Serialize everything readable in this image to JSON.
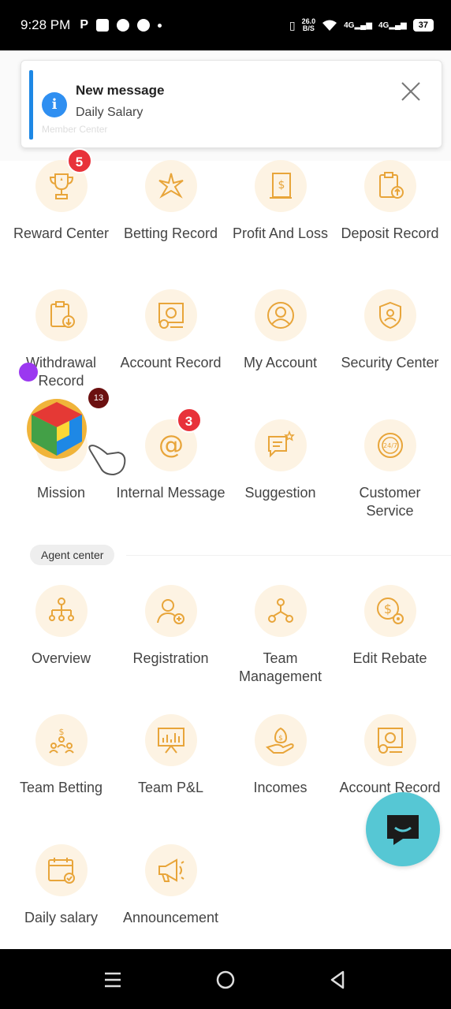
{
  "status_bar": {
    "time": "9:28 PM",
    "speed_value": "26.0",
    "speed_unit": "B/S",
    "network_1": "4G",
    "network_2": "4G",
    "battery": "37"
  },
  "notification": {
    "title": "New message",
    "body": "Daily Salary",
    "background_hint": "Member Center"
  },
  "member_center": {
    "items": [
      {
        "label": "Reward Center",
        "icon": "trophy-icon",
        "badge": "5"
      },
      {
        "label": "Betting Record",
        "icon": "star-burst-icon"
      },
      {
        "label": "Profit And Loss",
        "icon": "dollar-document-icon"
      },
      {
        "label": "Deposit Record",
        "icon": "clipboard-upload-icon"
      },
      {
        "label": "Withdrawal Record",
        "icon": "clipboard-download-icon"
      },
      {
        "label": "Account Record",
        "icon": "account-record-icon"
      },
      {
        "label": "My Account",
        "icon": "user-circle-icon"
      },
      {
        "label": "Security Center",
        "icon": "shield-user-icon"
      },
      {
        "label": "Mission",
        "icon": "mission-icon"
      },
      {
        "label": "Internal Message",
        "icon": "at-sign-icon",
        "badge": "3"
      },
      {
        "label": "Suggestion",
        "icon": "chat-star-icon"
      },
      {
        "label": "Customer Service",
        "icon": "support-24-7-icon"
      }
    ]
  },
  "agent_center": {
    "title": "Agent center",
    "items": [
      {
        "label": "Overview",
        "icon": "org-chart-icon"
      },
      {
        "label": "Registration",
        "icon": "add-user-icon"
      },
      {
        "label": "Team Management",
        "icon": "team-icon"
      },
      {
        "label": "Edit Rebate",
        "icon": "dollar-gear-icon"
      },
      {
        "label": "Team Betting",
        "icon": "team-betting-icon"
      },
      {
        "label": "Team P&L",
        "icon": "chart-board-icon"
      },
      {
        "label": "Incomes",
        "icon": "money-hand-icon"
      },
      {
        "label": "Account Record",
        "icon": "account-record-icon"
      },
      {
        "label": "Daily salary",
        "icon": "calendar-check-icon"
      },
      {
        "label": "Announcement",
        "icon": "megaphone-icon"
      }
    ]
  },
  "mission_float": {
    "count": "13"
  },
  "colors": {
    "accent_icon": "#e8a53a",
    "icon_bg": "#fdf3e3",
    "badge": "#e8323a",
    "chat_fab": "#56c7d4",
    "notify_bar": "#1e88e5"
  }
}
